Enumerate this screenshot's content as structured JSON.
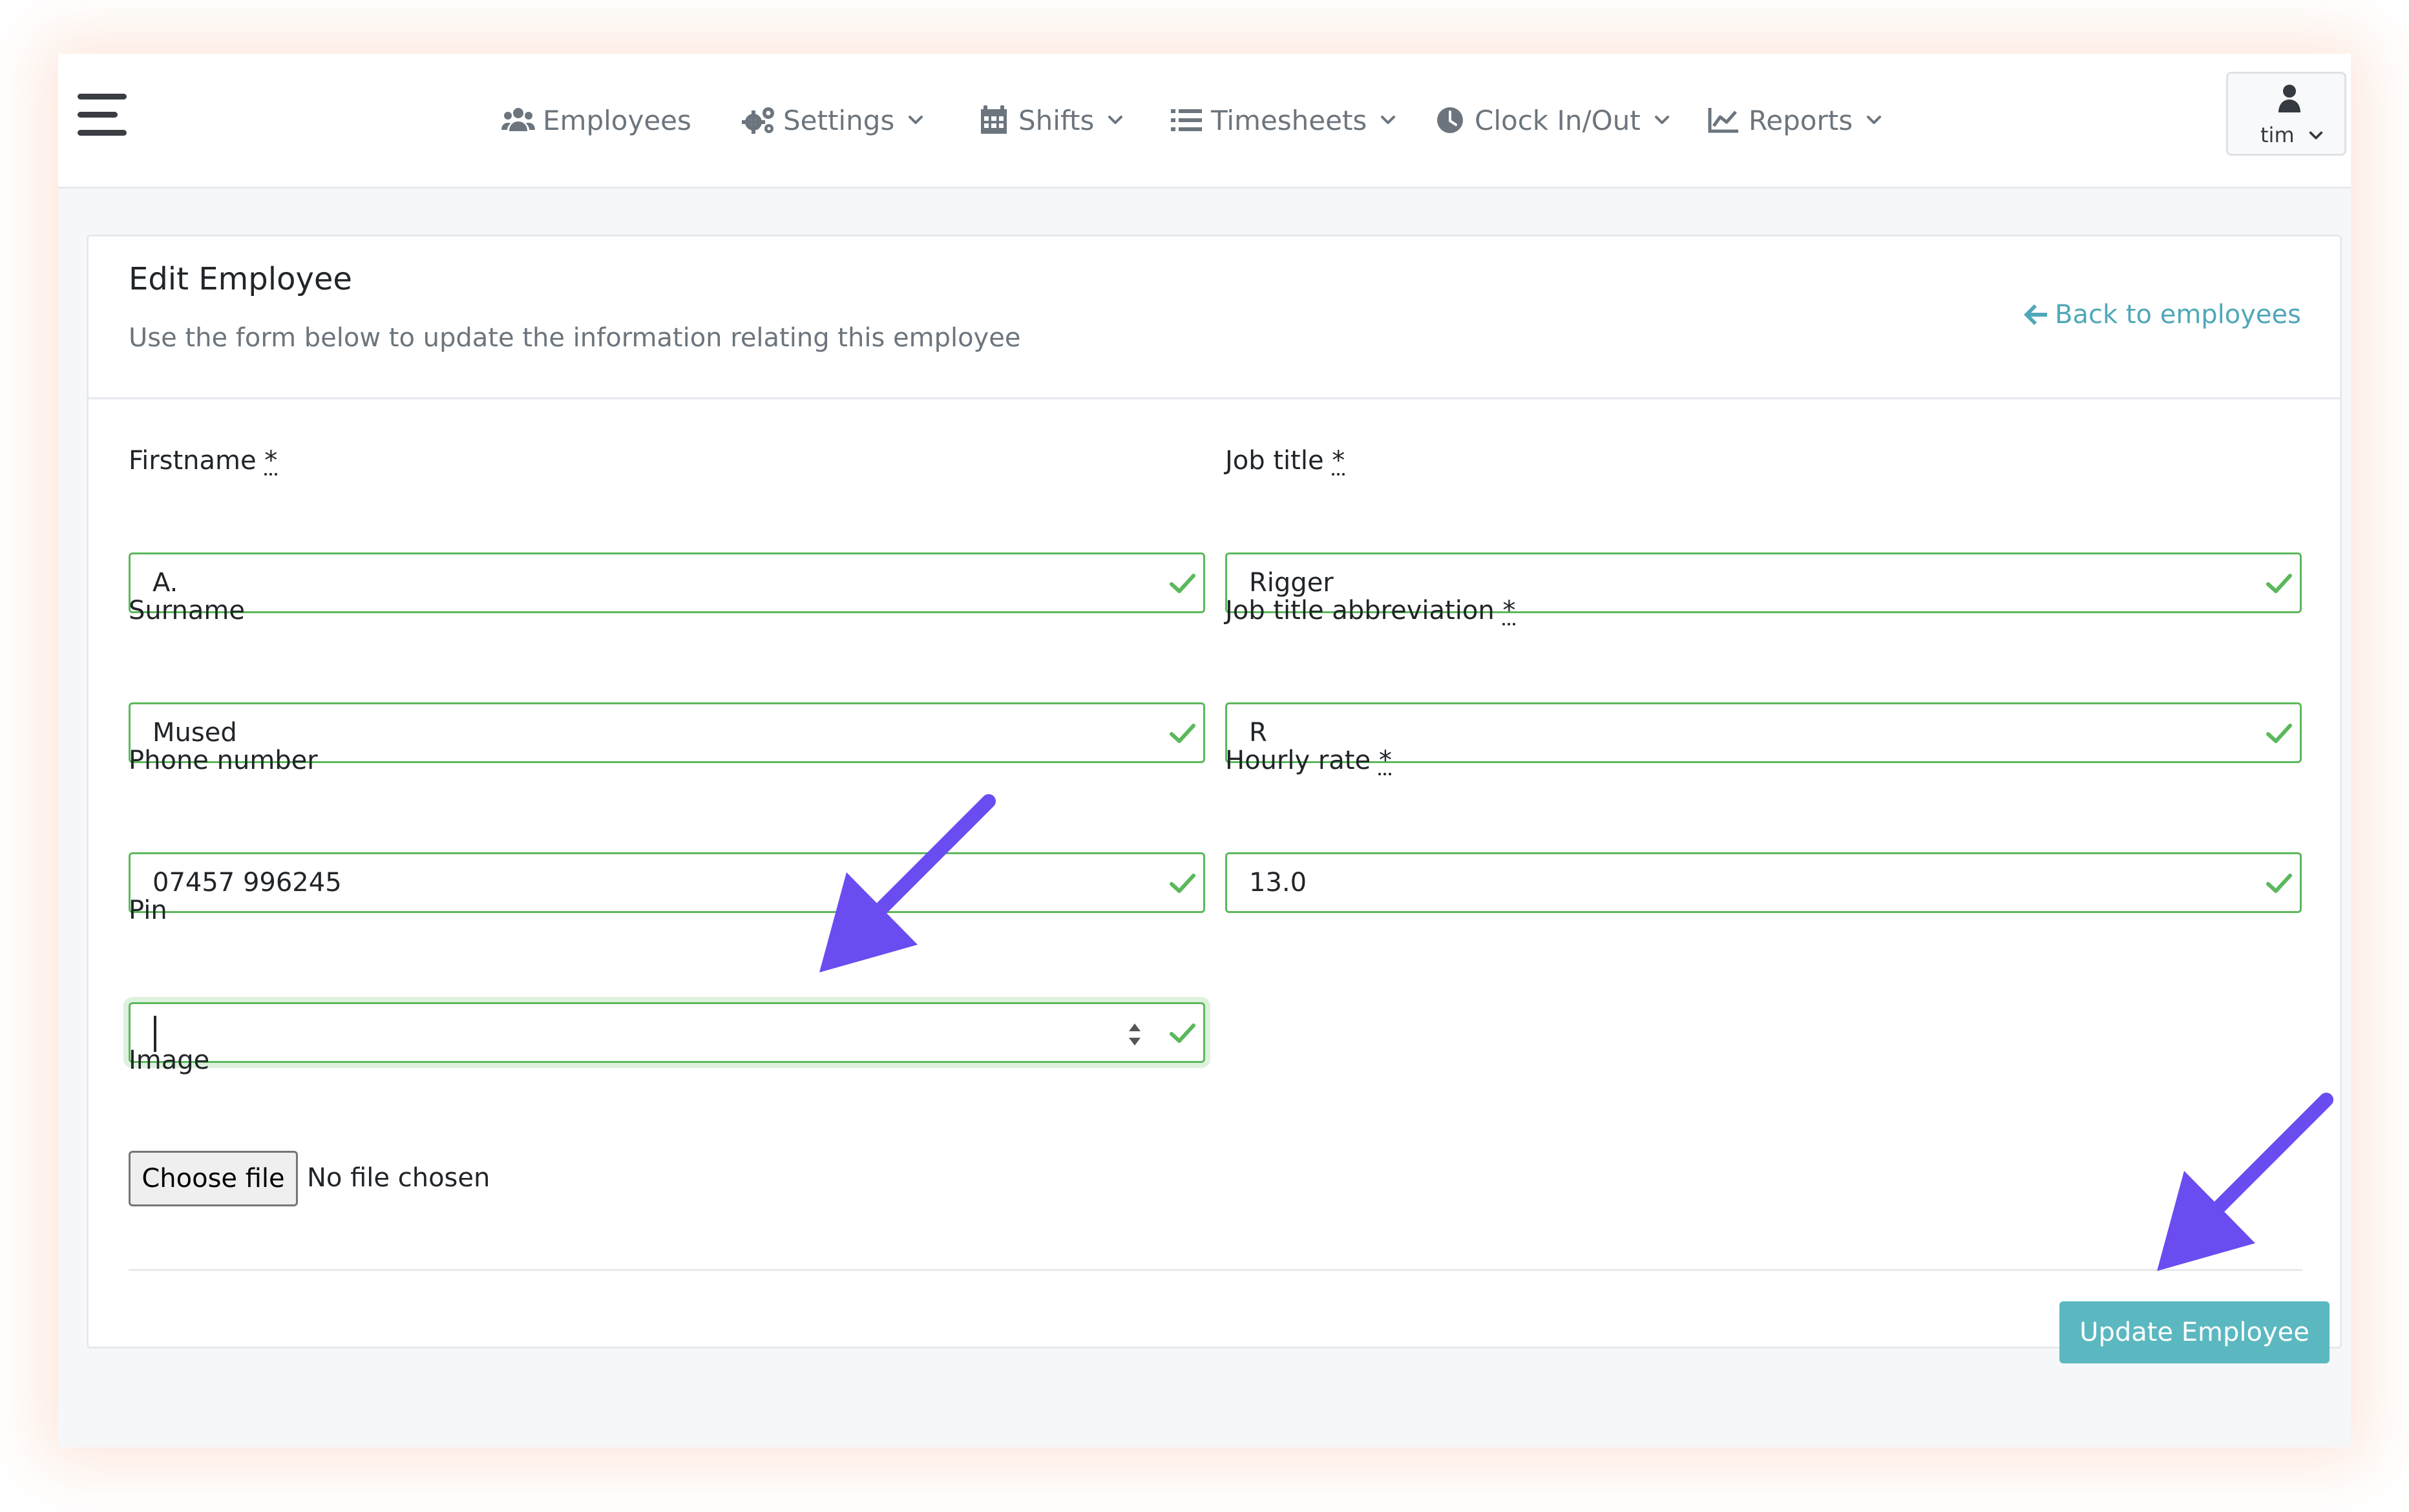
{
  "navbar": {
    "menu_icon": "hamburger-menu-icon",
    "items": [
      {
        "label": "Employees",
        "icon": "users-icon",
        "dropdown": false
      },
      {
        "label": "Settings",
        "icon": "gears-icon",
        "dropdown": true
      },
      {
        "label": "Shifts",
        "icon": "calendar-icon",
        "dropdown": true
      },
      {
        "label": "Timesheets",
        "icon": "list-icon",
        "dropdown": true
      },
      {
        "label": "Clock In/Out",
        "icon": "clock-icon",
        "dropdown": true
      },
      {
        "label": "Reports",
        "icon": "line-chart-icon",
        "dropdown": true
      }
    ],
    "user": {
      "name": "tim",
      "icon": "user-icon"
    }
  },
  "card": {
    "title": "Edit Employee",
    "subtitle": "Use the form below to update the information relating this employee",
    "back_link": "Back to employees"
  },
  "form": {
    "required_mark": "*",
    "firstname": {
      "label": "Firstname",
      "value": "A.",
      "required": true
    },
    "surname": {
      "label": "Surname",
      "value": "Mused",
      "required": false
    },
    "phone": {
      "label": "Phone number",
      "value": "07457 996245",
      "required": false
    },
    "pin": {
      "label": "Pin",
      "value": "",
      "required": false,
      "focused": true
    },
    "job_title": {
      "label": "Job title",
      "value": "Rigger",
      "required": true
    },
    "job_title_abbreviation": {
      "label": "Job title abbreviation",
      "value": "R",
      "required": true
    },
    "hourly_rate": {
      "label": "Hourly rate",
      "value": "13.0",
      "required": true
    },
    "image": {
      "label": "Image",
      "button": "Choose file",
      "status": "No file chosen"
    },
    "submit": "Update Employee"
  },
  "colors": {
    "accent": "#5bb8c0",
    "link": "#4fa8b8",
    "valid": "#5cb85c",
    "annotation_arrow": "#6a4cf0"
  }
}
